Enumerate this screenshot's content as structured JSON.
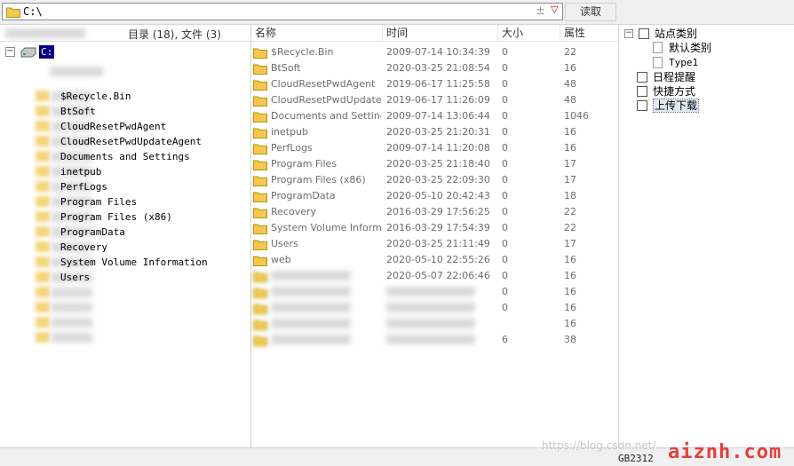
{
  "address_bar": {
    "path": "C:\\",
    "add_symbol": "±",
    "dropdown_symbol": "▽",
    "read_button": "读取"
  },
  "left_pane": {
    "summary": "目录 (18), 文件 (3)",
    "root_label": "C:",
    "items": [
      "$Recycle.Bin",
      "BtSoft",
      "CloudResetPwdAgent",
      "CloudResetPwdUpdateAgent",
      "Documents and Settings",
      "inetpub",
      "PerfLogs",
      "Program Files",
      "Program Files (x86)",
      "ProgramData",
      "Recovery",
      "System Volume Information",
      "Users"
    ]
  },
  "list": {
    "headers": {
      "name": "名称",
      "time": "时间",
      "size": "大小",
      "attr": "属性"
    },
    "rows": [
      {
        "name": "$Recycle.Bin",
        "time": "2009-07-14 10:34:39",
        "size": "0",
        "attr": "22"
      },
      {
        "name": "BtSoft",
        "time": "2020-03-25 21:08:54",
        "size": "0",
        "attr": "16"
      },
      {
        "name": "CloudResetPwdAgent",
        "time": "2019-06-17 11:25:58",
        "size": "0",
        "attr": "48"
      },
      {
        "name": "CloudResetPwdUpdate...",
        "time": "2019-06-17 11:26:09",
        "size": "0",
        "attr": "48"
      },
      {
        "name": "Documents and Settings",
        "time": "2009-07-14 13:06:44",
        "size": "0",
        "attr": "1046"
      },
      {
        "name": "inetpub",
        "time": "2020-03-25 21:20:31",
        "size": "0",
        "attr": "16"
      },
      {
        "name": "PerfLogs",
        "time": "2009-07-14 11:20:08",
        "size": "0",
        "attr": "16"
      },
      {
        "name": "Program Files",
        "time": "2020-03-25 21:18:40",
        "size": "0",
        "attr": "17"
      },
      {
        "name": "Program Files (x86)",
        "time": "2020-03-25 22:09:30",
        "size": "0",
        "attr": "17"
      },
      {
        "name": "ProgramData",
        "time": "2020-05-10 20:42:43",
        "size": "0",
        "attr": "18"
      },
      {
        "name": "Recovery",
        "time": "2016-03-29 17:56:25",
        "size": "0",
        "attr": "22"
      },
      {
        "name": "System Volume Informati...",
        "time": "2016-03-29 17:54:39",
        "size": "0",
        "attr": "22"
      },
      {
        "name": "Users",
        "time": "2020-03-25 21:11:49",
        "size": "0",
        "attr": "17"
      },
      {
        "name": "web",
        "time": "2020-05-10 22:55:26",
        "size": "0",
        "attr": "16"
      },
      {
        "name": "",
        "time": "2020-05-07 22:06:46",
        "size": "0",
        "attr": "16"
      },
      {
        "name": "",
        "time": "",
        "size": "0",
        "attr": "16"
      },
      {
        "name": "",
        "time": "",
        "size": "0",
        "attr": "16"
      },
      {
        "name": "",
        "time": "",
        "size": "",
        "attr": "16"
      },
      {
        "name": "",
        "time": "",
        "size": "6",
        "attr": "38"
      }
    ]
  },
  "right_tree": {
    "root": "站点类别",
    "children": [
      "默认类别",
      "Type1"
    ],
    "items": [
      "日程提醒",
      "快捷方式",
      "上传下载"
    ]
  },
  "status": {
    "encoding": "GB2312",
    "watermark_url": "https://blog.csdn.net/...",
    "watermark_brand": "aiznh.com"
  },
  "colors": {
    "selection": "#000080",
    "folder": "#f2c94c",
    "watermark": "#e04040"
  }
}
